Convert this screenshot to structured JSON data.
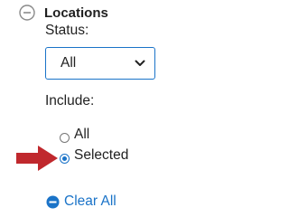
{
  "section": {
    "title": "Locations",
    "collapse_icon": "minus-circle-icon"
  },
  "status": {
    "label": "Status:",
    "selected_value": "All"
  },
  "include": {
    "label": "Include:",
    "options": [
      {
        "label": "All",
        "checked": false
      },
      {
        "label": "Selected",
        "checked": true
      }
    ]
  },
  "clear_all": {
    "label": "Clear All",
    "icon": "minus-circle-filled-icon"
  },
  "annotation": {
    "icon": "red-arrow-icon"
  },
  "colors": {
    "accent": "#1a73c8",
    "arrow": "#c0282d",
    "text": "#222222",
    "icon_gray": "#8a8a8a"
  }
}
